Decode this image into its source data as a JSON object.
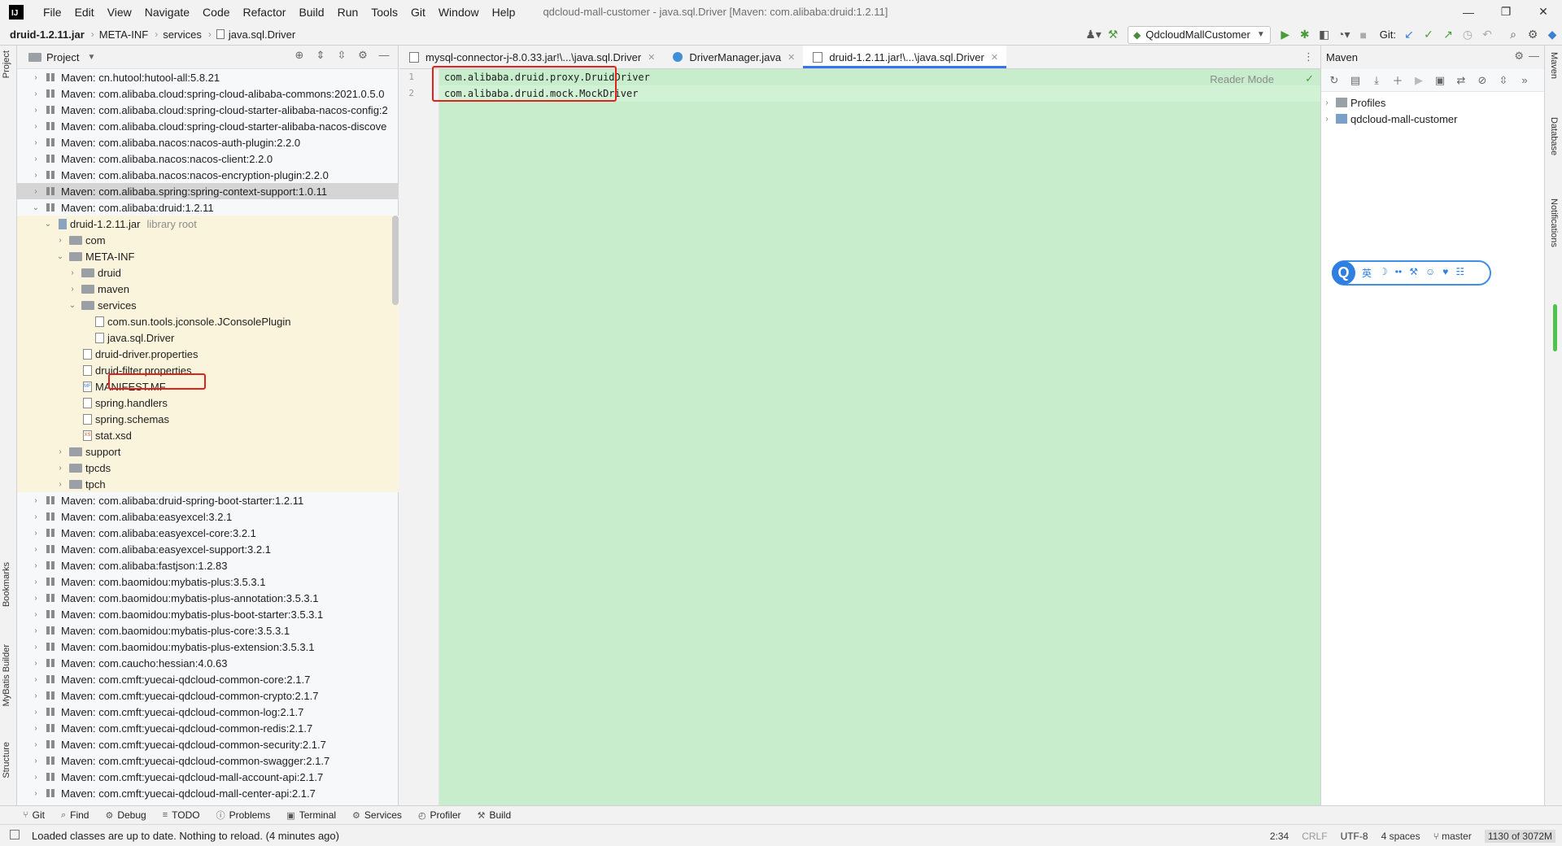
{
  "menubar": {
    "logo": "IJ",
    "items": [
      "File",
      "Edit",
      "View",
      "Navigate",
      "Code",
      "Refactor",
      "Build",
      "Run",
      "Tools",
      "Git",
      "Window",
      "Help"
    ],
    "window_title": "qdcloud-mall-customer - java.sql.Driver [Maven: com.alibaba:druid:1.2.11]",
    "controls": [
      "—",
      "❐",
      "✕"
    ]
  },
  "breadcrumb": [
    "druid-1.2.11.jar",
    "META-INF",
    "services",
    "java.sql.Driver"
  ],
  "toolbar": {
    "run_config": "QdcloudMallCustomer",
    "git_label": "Git:"
  },
  "left_stripe": [
    "Project",
    "Bookmarks",
    "MyBatis Builder",
    "Structure"
  ],
  "right_stripe": [
    "Maven",
    "Database",
    "Notifications"
  ],
  "project": {
    "title": "Project",
    "tree": [
      {
        "depth": 0,
        "toggle": "›",
        "icon": "lib",
        "label": "Maven: cn.hutool:hutool-all:5.8.21"
      },
      {
        "depth": 0,
        "toggle": "›",
        "icon": "lib",
        "label": "Maven: com.alibaba.cloud:spring-cloud-alibaba-commons:2021.0.5.0"
      },
      {
        "depth": 0,
        "toggle": "›",
        "icon": "lib",
        "label": "Maven: com.alibaba.cloud:spring-cloud-starter-alibaba-nacos-config:2"
      },
      {
        "depth": 0,
        "toggle": "›",
        "icon": "lib",
        "label": "Maven: com.alibaba.cloud:spring-cloud-starter-alibaba-nacos-discove"
      },
      {
        "depth": 0,
        "toggle": "›",
        "icon": "lib",
        "label": "Maven: com.alibaba.nacos:nacos-auth-plugin:2.2.0"
      },
      {
        "depth": 0,
        "toggle": "›",
        "icon": "lib",
        "label": "Maven: com.alibaba.nacos:nacos-client:2.2.0"
      },
      {
        "depth": 0,
        "toggle": "›",
        "icon": "lib",
        "label": "Maven: com.alibaba.nacos:nacos-encryption-plugin:2.2.0"
      },
      {
        "depth": 0,
        "toggle": "›",
        "icon": "lib",
        "label": "Maven: com.alibaba.spring:spring-context-support:1.0.11",
        "state": "selected"
      },
      {
        "depth": 0,
        "toggle": "⌄",
        "icon": "lib",
        "label": "Maven: com.alibaba:druid:1.2.11"
      },
      {
        "depth": 1,
        "toggle": "⌄",
        "icon": "jar",
        "label": "druid-1.2.11.jar",
        "hint": "library root",
        "state": "highlighted"
      },
      {
        "depth": 2,
        "toggle": "›",
        "icon": "folder",
        "label": "com",
        "state": "highlighted"
      },
      {
        "depth": 2,
        "toggle": "⌄",
        "icon": "folder",
        "label": "META-INF",
        "state": "highlighted"
      },
      {
        "depth": 3,
        "toggle": "›",
        "icon": "folder",
        "label": "druid",
        "state": "highlighted"
      },
      {
        "depth": 3,
        "toggle": "›",
        "icon": "folder",
        "label": "maven",
        "state": "highlighted"
      },
      {
        "depth": 3,
        "toggle": "⌄",
        "icon": "folder",
        "label": "services",
        "state": "highlighted"
      },
      {
        "depth": 4,
        "toggle": "",
        "icon": "file",
        "label": "com.sun.tools.jconsole.JConsolePlugin",
        "state": "highlighted"
      },
      {
        "depth": 4,
        "toggle": "",
        "icon": "file",
        "label": "java.sql.Driver",
        "state": "highlighted",
        "boxed": true
      },
      {
        "depth": 3,
        "toggle": "",
        "icon": "file",
        "label": "druid-driver.properties",
        "state": "highlighted"
      },
      {
        "depth": 3,
        "toggle": "",
        "icon": "file",
        "label": "druid-filter.properties",
        "state": "highlighted"
      },
      {
        "depth": 3,
        "toggle": "",
        "icon": "mf",
        "label": "MANIFEST.MF",
        "state": "highlighted"
      },
      {
        "depth": 3,
        "toggle": "",
        "icon": "file",
        "label": "spring.handlers",
        "state": "highlighted"
      },
      {
        "depth": 3,
        "toggle": "",
        "icon": "file",
        "label": "spring.schemas",
        "state": "highlighted"
      },
      {
        "depth": 3,
        "toggle": "",
        "icon": "xsd",
        "label": "stat.xsd",
        "state": "highlighted"
      },
      {
        "depth": 2,
        "toggle": "›",
        "icon": "folder",
        "label": "support",
        "state": "highlighted"
      },
      {
        "depth": 2,
        "toggle": "›",
        "icon": "folder",
        "label": "tpcds",
        "state": "highlighted"
      },
      {
        "depth": 2,
        "toggle": "›",
        "icon": "folder",
        "label": "tpch",
        "state": "highlighted"
      },
      {
        "depth": 0,
        "toggle": "›",
        "icon": "lib",
        "label": "Maven: com.alibaba:druid-spring-boot-starter:1.2.11"
      },
      {
        "depth": 0,
        "toggle": "›",
        "icon": "lib",
        "label": "Maven: com.alibaba:easyexcel:3.2.1"
      },
      {
        "depth": 0,
        "toggle": "›",
        "icon": "lib",
        "label": "Maven: com.alibaba:easyexcel-core:3.2.1"
      },
      {
        "depth": 0,
        "toggle": "›",
        "icon": "lib",
        "label": "Maven: com.alibaba:easyexcel-support:3.2.1"
      },
      {
        "depth": 0,
        "toggle": "›",
        "icon": "lib",
        "label": "Maven: com.alibaba:fastjson:1.2.83"
      },
      {
        "depth": 0,
        "toggle": "›",
        "icon": "lib",
        "label": "Maven: com.baomidou:mybatis-plus:3.5.3.1"
      },
      {
        "depth": 0,
        "toggle": "›",
        "icon": "lib",
        "label": "Maven: com.baomidou:mybatis-plus-annotation:3.5.3.1"
      },
      {
        "depth": 0,
        "toggle": "›",
        "icon": "lib",
        "label": "Maven: com.baomidou:mybatis-plus-boot-starter:3.5.3.1"
      },
      {
        "depth": 0,
        "toggle": "›",
        "icon": "lib",
        "label": "Maven: com.baomidou:mybatis-plus-core:3.5.3.1"
      },
      {
        "depth": 0,
        "toggle": "›",
        "icon": "lib",
        "label": "Maven: com.baomidou:mybatis-plus-extension:3.5.3.1"
      },
      {
        "depth": 0,
        "toggle": "›",
        "icon": "lib",
        "label": "Maven: com.caucho:hessian:4.0.63"
      },
      {
        "depth": 0,
        "toggle": "›",
        "icon": "lib",
        "label": "Maven: com.cmft:yuecai-qdcloud-common-core:2.1.7"
      },
      {
        "depth": 0,
        "toggle": "›",
        "icon": "lib",
        "label": "Maven: com.cmft:yuecai-qdcloud-common-crypto:2.1.7"
      },
      {
        "depth": 0,
        "toggle": "›",
        "icon": "lib",
        "label": "Maven: com.cmft:yuecai-qdcloud-common-log:2.1.7"
      },
      {
        "depth": 0,
        "toggle": "›",
        "icon": "lib",
        "label": "Maven: com.cmft:yuecai-qdcloud-common-redis:2.1.7"
      },
      {
        "depth": 0,
        "toggle": "›",
        "icon": "lib",
        "label": "Maven: com.cmft:yuecai-qdcloud-common-security:2.1.7"
      },
      {
        "depth": 0,
        "toggle": "›",
        "icon": "lib",
        "label": "Maven: com.cmft:yuecai-qdcloud-common-swagger:2.1.7"
      },
      {
        "depth": 0,
        "toggle": "›",
        "icon": "lib",
        "label": "Maven: com.cmft:yuecai-qdcloud-mall-account-api:2.1.7"
      },
      {
        "depth": 0,
        "toggle": "›",
        "icon": "lib",
        "label": "Maven: com.cmft:yuecai-qdcloud-mall-center-api:2.1.7"
      }
    ]
  },
  "editor": {
    "tabs": [
      {
        "label": "mysql-connector-j-8.0.33.jar!\\...\\java.sql.Driver",
        "icon": "file",
        "active": false
      },
      {
        "label": "DriverManager.java",
        "icon": "class",
        "active": false
      },
      {
        "label": "druid-1.2.11.jar!\\...\\java.sql.Driver",
        "icon": "file",
        "active": true
      }
    ],
    "lines": [
      {
        "number": "1",
        "text": "com.alibaba.druid.proxy.DruidDriver"
      },
      {
        "number": "2",
        "text": "com.alibaba.druid.mock.MockDriver"
      }
    ],
    "reader_mode": "Reader Mode"
  },
  "maven": {
    "title": "Maven",
    "items": [
      {
        "label": "Profiles"
      },
      {
        "label": "qdcloud-mall-customer"
      }
    ]
  },
  "ime": {
    "logo": "Q",
    "items": [
      "英",
      "☽",
      "••",
      "⚒",
      "☺",
      "♥",
      "☷"
    ]
  },
  "bottom_tools": [
    {
      "icon": "⑂",
      "label": "Git"
    },
    {
      "icon": "⌕",
      "label": "Find"
    },
    {
      "icon": "⚙",
      "label": "Debug"
    },
    {
      "icon": "≡",
      "label": "TODO"
    },
    {
      "icon": "ⓘ",
      "label": "Problems"
    },
    {
      "icon": "▣",
      "label": "Terminal"
    },
    {
      "icon": "⚙",
      "label": "Services"
    },
    {
      "icon": "◴",
      "label": "Profiler"
    },
    {
      "icon": "⚒",
      "label": "Build"
    }
  ],
  "status": {
    "message": "Loaded classes are up to date. Nothing to reload. (4 minutes ago)",
    "position": "2:34",
    "line_sep": "CRLF",
    "encoding": "UTF-8",
    "indent": "4 spaces",
    "branch": "master",
    "memory": "1130 of 3072M"
  },
  "colors": {
    "editor_bg": "#c7edcc",
    "highlight_box": "#e0221c",
    "selection_accent": "#3574f0"
  }
}
